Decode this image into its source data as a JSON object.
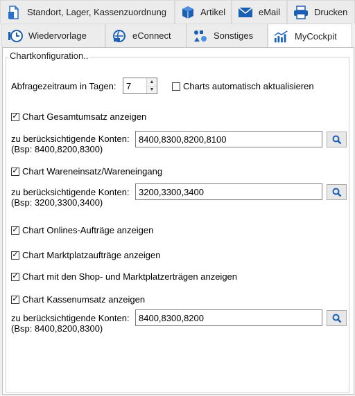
{
  "tabs": {
    "row1": [
      {
        "label": "Standort, Lager, Kassenzuordnung",
        "icon": "document-icon"
      },
      {
        "label": "Artikel",
        "icon": "cube-icon"
      },
      {
        "label": "eMail",
        "icon": "email-icon"
      },
      {
        "label": "Drucken",
        "icon": "printer-icon"
      }
    ],
    "row2": [
      {
        "label": "Wiedervorlage",
        "icon": "clock-icon"
      },
      {
        "label": "eConnect",
        "icon": "econnect-icon"
      },
      {
        "label": "Sonstiges",
        "icon": "sonstiges-icon"
      },
      {
        "label": "MyCockpit",
        "icon": "chart-icon",
        "active": true
      }
    ]
  },
  "group": {
    "title": "Chartkonfiguration.."
  },
  "query": {
    "label": "Abfragezeitraum in Tagen:",
    "value": "7",
    "auto_refresh_label": "Charts automatisch aktualisieren",
    "auto_refresh_checked": false
  },
  "charts": {
    "gesamtumsatz": {
      "label": "Chart Gesamtumsatz anzeigen",
      "checked": true,
      "konten_label": "zu berücksichtigende Konten:",
      "hint": "(Bsp: 8400,8200,8300)",
      "value": "8400,8300,8200,8100"
    },
    "wareneinsatz": {
      "label": "Chart Wareneinsatz/Wareneingang",
      "checked": true,
      "konten_label": "zu berücksichtigende Konten:",
      "hint": "(Bsp: 3200,3300,3400)",
      "value": "3200,3300,3400"
    },
    "online": {
      "label": "Chart Onlines-Aufträge anzeigen",
      "checked": true
    },
    "marktplatz": {
      "label": "Chart Marktplatzaufträge anzeigen",
      "checked": true
    },
    "shop": {
      "label": "Chart mit den Shop- und Marktplatzerträgen anzeigen",
      "checked": true
    },
    "kassenumsatz": {
      "label": "Chart Kassenumsatz anzeigen",
      "checked": true,
      "konten_label": "zu berücksichtigende Konten:",
      "hint": "(Bsp: 8400,8200,8300)",
      "value": "8400,8300,8200"
    }
  },
  "colors": {
    "accent": "#1a5fb4",
    "icon_blue": "#2a6fc9"
  }
}
